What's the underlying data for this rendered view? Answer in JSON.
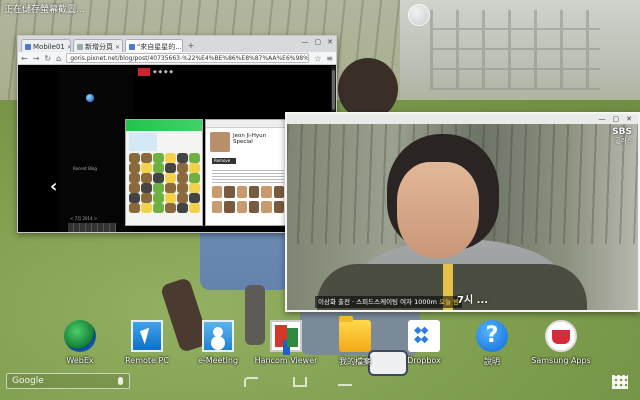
{
  "status_bar": {
    "text": "正在儲存螢幕截圖..."
  },
  "browser": {
    "tabs": [
      {
        "label": "Mobile01",
        "active": false
      },
      {
        "label": "新增分頁",
        "active": false
      },
      {
        "label": "\"來自星星的...",
        "active": true
      }
    ],
    "url": "goris.pixnet.net/blog/post/40735663-%22%E4%BE%86%E8%87%AA%E6%98%9F%E6%98%9F%E7%9A%84",
    "page": {
      "header_text": "◆ ◆ ◆ ◆",
      "sidebar_label": "Recent Blog",
      "sidebar_date": "< 7月 2014 >",
      "detail_title": "Jeon Ji-Hyun Special",
      "detail_button": "Remove"
    }
  },
  "video": {
    "logo": "SBS",
    "logo_sub": "플러스",
    "subtitle_main": "이상화 출전 · 스피드스케이팅 여자 1000m",
    "subtitle_highlight": "오늘 밤",
    "subtitle_big": "7시 ..."
  },
  "dock": {
    "apps": [
      {
        "label": "WebEx",
        "icon": "webex-icon"
      },
      {
        "label": "Remote PC",
        "icon": "remote-pc-icon"
      },
      {
        "label": "e-Meeting",
        "icon": "e-meeting-icon"
      },
      {
        "label": "Hancom Viewer",
        "icon": "hancom-viewer-icon"
      },
      {
        "label": "我的檔案",
        "icon": "folder-icon"
      },
      {
        "label": "Dropbox",
        "icon": "dropbox-icon"
      },
      {
        "label": "說明",
        "icon": "help-icon"
      },
      {
        "label": "Samsung Apps",
        "icon": "samsung-apps-icon"
      }
    ]
  },
  "search": {
    "label": "Google"
  }
}
